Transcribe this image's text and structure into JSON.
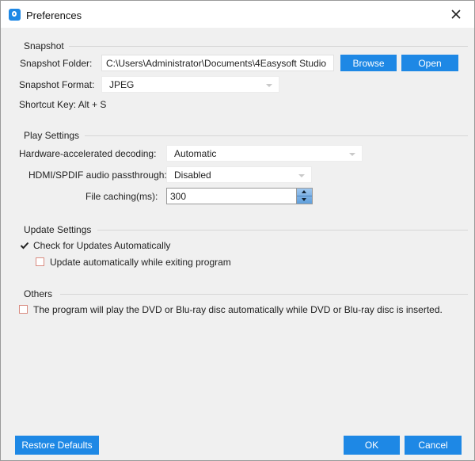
{
  "window": {
    "title": "Preferences"
  },
  "snapshot": {
    "group_title": "Snapshot",
    "folder_label": "Snapshot Folder:",
    "folder_value": "C:\\Users\\Administrator\\Documents\\4Easysoft Studio",
    "browse_label": "Browse",
    "open_label": "Open",
    "format_label": "Snapshot Format:",
    "format_value": "JPEG",
    "shortcut_text": "Shortcut Key: Alt + S"
  },
  "play": {
    "group_title": "Play Settings",
    "hw_label": "Hardware-accelerated decoding:",
    "hw_value": "Automatic",
    "hdmi_label": "HDMI/SPDIF audio passthrough:",
    "hdmi_value": "Disabled",
    "cache_label": "File caching(ms):",
    "cache_value": "300"
  },
  "update": {
    "group_title": "Update Settings",
    "check_auto_label": "Check for Updates Automatically",
    "check_auto_checked": true,
    "update_exit_label": "Update automatically while exiting program",
    "update_exit_checked": false
  },
  "others": {
    "group_title": "Others",
    "autoplay_label": "The program will play the DVD or Blu-ray disc automatically while DVD or Blu-ray disc is inserted.",
    "autoplay_checked": false
  },
  "footer": {
    "restore_label": "Restore Defaults",
    "ok_label": "OK",
    "cancel_label": "Cancel"
  },
  "colors": {
    "accent": "#1e88e5",
    "unchecked_border": "#d98b80"
  },
  "icons": {
    "app": "app-logo-icon",
    "close": "close-icon",
    "check": "checkmark-icon"
  }
}
